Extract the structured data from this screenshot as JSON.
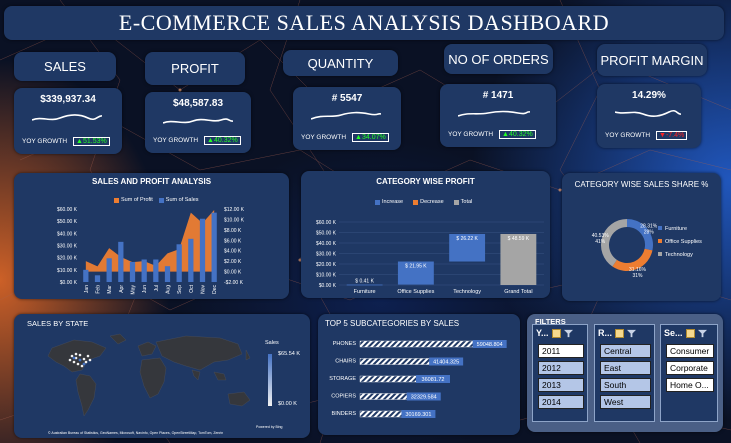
{
  "title": "E-COMMERCE SALES ANALYSIS DASHBOARD",
  "kpis": [
    {
      "label": "SALES",
      "value": "$339,937.34",
      "yoy_label": "YOY GROWTH",
      "yoy": "▲51.53%",
      "direction": "up"
    },
    {
      "label": "PROFIT",
      "value": "$48,587.83",
      "yoy_label": "YOY GROWTH",
      "yoy": "▲40.32%",
      "direction": "up"
    },
    {
      "label": "QUANTITY",
      "value": "# 5547",
      "yoy_label": "YOY GROWTH",
      "yoy": "▲34.07%",
      "direction": "up"
    },
    {
      "label": "NO OF ORDERS",
      "value": "# 1471",
      "yoy_label": "YOY GROWTH",
      "yoy": "▲40.32%",
      "direction": "up"
    },
    {
      "label": "PROFIT MARGIN",
      "value": "14.29%",
      "yoy_label": "YOY GROWTH",
      "yoy": "▼-7.4%",
      "direction": "down"
    }
  ],
  "sales_profit": {
    "title": "SALES AND PROFIT ANALYSIS",
    "legend_profit": "Sum of Profit",
    "legend_sales": "Sum of Sales",
    "left_ticks": [
      "$60.00 K",
      "$50.00 K",
      "$40.00 K",
      "$30.00 K",
      "$20.00 K",
      "$10.00 K",
      "$0.00 K"
    ],
    "right_ticks": [
      "$12.00 K",
      "$10.00 K",
      "$8.00 K",
      "$6.00 K",
      "$4.00 K",
      "$2.00 K",
      "$0.00 K",
      "-$2.00 K"
    ]
  },
  "category_profit": {
    "title": "CATEGORY WISE PROFIT",
    "legend": [
      "Increase",
      "Decrease",
      "Total"
    ],
    "y_ticks": [
      "$60.00 K",
      "$50.00 K",
      "$40.00 K",
      "$30.00 K",
      "$20.00 K",
      "$10.00 K",
      "$0.00 K"
    ],
    "labels": [
      "$ 0.41 K",
      "$ 21.95 K",
      "$ 26.22 K",
      "$ 48.59 K"
    ]
  },
  "category_share": {
    "title": "CATEGORY WISE SALES SHARE %",
    "labels": [
      "28.31%",
      "31.16%",
      "40.53%"
    ],
    "extra_labels": [
      "28%",
      "31%",
      "41%"
    ],
    "legend": [
      "Furniture",
      "Office Supplies",
      "Technology"
    ]
  },
  "sales_by_state": {
    "title": "SALES BY STATE",
    "legend_title": "Sales",
    "legend_max": "$65.54 K",
    "legend_min": "$0.00 K",
    "powered": "Powered by Bing",
    "credits": "© Australian Bureau of Statistics, GeoNames, Microsoft, Navinfo, Open Places, OpenStreetMap, TomTom, Zenrin"
  },
  "top5": {
    "title": "TOP 5 SUBCATEGORIES BY SALES",
    "labels": [
      "59048.804",
      "41404.325",
      "36081.72",
      "32329.584",
      "30169.301"
    ]
  },
  "filters": {
    "title": "FILTERS",
    "year_head": "Y...",
    "region_head": "R...",
    "segment_head": "Se...",
    "years": [
      "2011",
      "2012",
      "2013",
      "2014"
    ],
    "regions": [
      "Central",
      "East",
      "South",
      "West"
    ],
    "segments": [
      "Consumer",
      "Corporate",
      "Home O..."
    ]
  },
  "chart_data": [
    {
      "type": "bar",
      "title": "SALES AND PROFIT ANALYSIS",
      "categories": [
        "Jan",
        "Feb",
        "Mar",
        "Apr",
        "May",
        "Jun",
        "Jul",
        "Aug",
        "Sep",
        "Oct",
        "Nov",
        "Dec"
      ],
      "series": [
        {
          "name": "Sum of Sales",
          "values": [
            10000,
            5500,
            19500,
            33000,
            16500,
            18500,
            18500,
            13000,
            31000,
            35500,
            52000,
            57000
          ]
        },
        {
          "name": "Sum of Profit",
          "values": [
            2000,
            1000,
            4500,
            2800,
            1800,
            2000,
            1100,
            3500,
            4300,
            11300,
            9300,
            11800
          ]
        }
      ],
      "ylim": [
        0,
        60000
      ],
      "y2lim": [
        -2000,
        12000
      ]
    },
    {
      "type": "bar",
      "title": "CATEGORY WISE PROFIT",
      "categories": [
        "Furniture",
        "Office Supplies",
        "Technology",
        "Grand Total"
      ],
      "values": [
        0.41,
        21.95,
        26.22,
        48.59
      ],
      "ylim": [
        0,
        60
      ]
    },
    {
      "type": "pie",
      "title": "CATEGORY WISE SALES SHARE %",
      "categories": [
        "Furniture",
        "Office Supplies",
        "Technology"
      ],
      "values": [
        28.31,
        31.16,
        40.53
      ]
    },
    {
      "type": "bar",
      "title": "TOP 5 SUBCATEGORIES BY SALES",
      "categories": [
        "PHONES",
        "CHAIRS",
        "STORAGE",
        "COPIERS",
        "BINDERS"
      ],
      "values": [
        59048.804,
        41404.325,
        36081.72,
        32329.584,
        30169.301
      ]
    }
  ],
  "colors": {
    "panel": "#1f3864",
    "sales": "#4472c4",
    "profit": "#ed7d31",
    "total": "#a5a5a5",
    "up": "#22ff22",
    "down": "#ff2020"
  }
}
